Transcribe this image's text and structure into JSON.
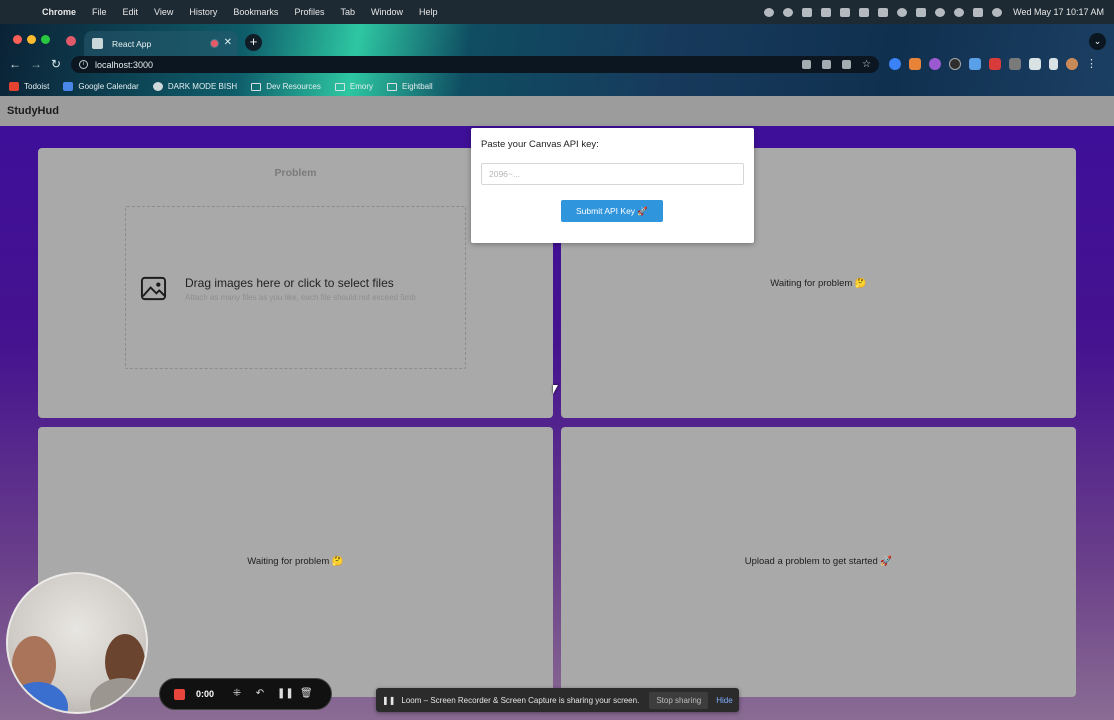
{
  "menubar": {
    "app": "Chrome",
    "items": [
      "File",
      "Edit",
      "View",
      "History",
      "Bookmarks",
      "Profiles",
      "Tab",
      "Window",
      "Help"
    ],
    "clock": "Wed May 17  10:17 AM"
  },
  "browser": {
    "tab_title": "React App",
    "url": "localhost:3000",
    "bookmarks": [
      "Todoist",
      "Google Calendar",
      "DARK MODE BISH",
      "Dev Resources",
      "Emory",
      "Eightball"
    ]
  },
  "app": {
    "brand": "StudyHud",
    "panels": {
      "problem_title": "Problem",
      "dropzone_title": "Drag images here or click to select files",
      "dropzone_subtitle": "Attach as many files as you like, each file should not exceed 5mb",
      "top_right_msg": "Waiting for problem 🤔",
      "bottom_left_msg": "Waiting for problem 🤔",
      "bottom_right_msg": "Upload a problem to get started 🚀"
    },
    "modal": {
      "label": "Paste your Canvas API key:",
      "placeholder": "2096~...",
      "value": "",
      "submit_label": "Submit API Key 🚀"
    }
  },
  "loom": {
    "timer": "0:00",
    "share_text": "Loom – Screen Recorder & Screen Capture is sharing your screen.",
    "stop_label": "Stop sharing",
    "hide_label": "Hide"
  },
  "colors": {
    "accent_button": "#2f95dd",
    "record_red": "#e8453c",
    "page_purple": "#3d0e9a"
  }
}
